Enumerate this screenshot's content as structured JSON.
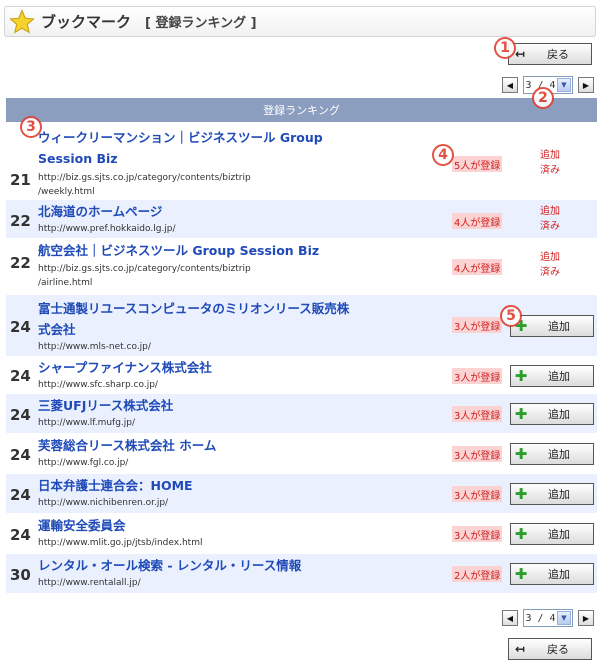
{
  "header": {
    "title": "ブックマーク",
    "subtitle": "[ 登録ランキング ]"
  },
  "back_label": "戻る",
  "pager": {
    "current": "3 / 4"
  },
  "table_title": "登録ランキング",
  "add_label": "追加",
  "markers": [
    "1",
    "2",
    "3",
    "4",
    "5"
  ],
  "rows": [
    {
      "rank": "21",
      "name_line1": "ウィークリーマンション｜ビジネスツール Group",
      "name_line2": "Session Biz",
      "url_line1": "http://biz.gs.sjts.co.jp/category/contents/biztrip",
      "url_line2": "/weekly.html",
      "count": "5人が登録",
      "status_line1": "追加",
      "status_line2": "済み"
    },
    {
      "rank": "22",
      "name_line1": "北海道のホームページ",
      "url_line1": "http://www.pref.hokkaido.lg.jp/",
      "count": "4人が登録",
      "status_line1": "追加",
      "status_line2": "済み"
    },
    {
      "rank": "22",
      "name_line1": "航空会社｜ビジネスツール Group Session Biz",
      "url_line1": "http://biz.gs.sjts.co.jp/category/contents/biztrip",
      "url_line2": "/airline.html",
      "count": "4人が登録",
      "status_line1": "追加",
      "status_line2": "済み"
    },
    {
      "rank": "24",
      "name_line1": "富士通製リユースコンピュータのミリオンリース販売株",
      "name_line2": "式会社",
      "url_line1": "http://www.mls-net.co.jp/",
      "count": "3人が登録"
    },
    {
      "rank": "24",
      "name_line1": "シャープファイナンス株式会社",
      "url_line1": "http://www.sfc.sharp.co.jp/",
      "count": "3人が登録"
    },
    {
      "rank": "24",
      "name_line1": "三菱UFJリース株式会社",
      "url_line1": "http://www.lf.mufg.jp/",
      "count": "3人が登録"
    },
    {
      "rank": "24",
      "name_line1": "芙蓉総合リース株式会社 ホーム",
      "url_line1": "http://www.fgl.co.jp/",
      "count": "3人が登録"
    },
    {
      "rank": "24",
      "name_line1": "日本弁護士連合会：HOME",
      "url_line1": "http://www.nichibenren.or.jp/",
      "count": "3人が登録"
    },
    {
      "rank": "24",
      "name_line1": "運輸安全委員会",
      "url_line1": "http://www.mlit.go.jp/jtsb/index.html",
      "count": "3人が登録"
    },
    {
      "rank": "30",
      "name_line1": "レンタル・オール検索 - レンタル・リース情報",
      "url_line1": "http://www.rentalall.jp/",
      "count": "2人が登録"
    }
  ]
}
